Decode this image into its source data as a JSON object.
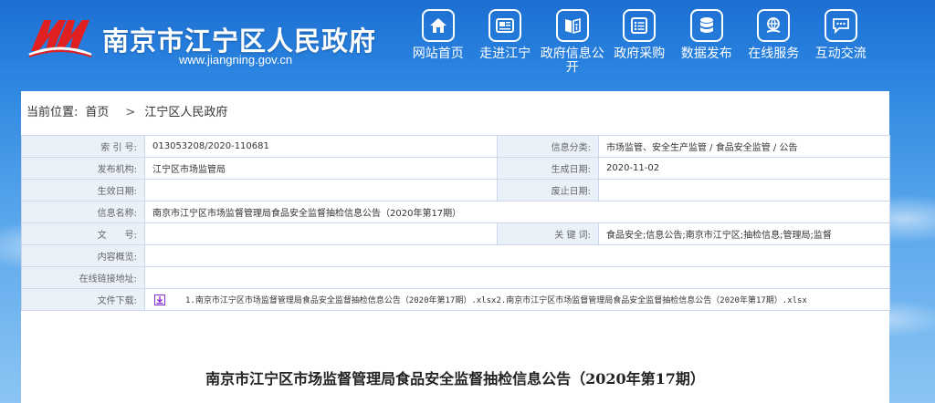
{
  "header": {
    "site_title": "南京市江宁区人民政府",
    "site_url": "www.jiangning.gov.cn"
  },
  "nav": [
    {
      "label": "网站首页",
      "icon": "home-icon"
    },
    {
      "label": "走进江宁",
      "icon": "newspaper-icon"
    },
    {
      "label": "政府信息公开",
      "icon": "info-book-icon"
    },
    {
      "label": "政府采购",
      "icon": "list-icon"
    },
    {
      "label": "数据发布",
      "icon": "database-icon"
    },
    {
      "label": "在线服务",
      "icon": "globe-hand-icon"
    },
    {
      "label": "互动交流",
      "icon": "chat-icon"
    }
  ],
  "breadcrumb": {
    "prefix": "当前位置:",
    "home": "首页",
    "separator": ">",
    "current": "江宁区人民政府"
  },
  "meta": {
    "index_label": "索 引 号:",
    "index_value": "013053208/2020-110681",
    "category_label": "信息分类:",
    "category_value": "市场监管、安全生产监管 / 食品安全监管 / 公告",
    "org_label": "发布机构:",
    "org_value": "江宁区市场监管局",
    "date_label": "生成日期:",
    "date_value": "2020-11-02",
    "effective_label": "生效日期:",
    "effective_value": "",
    "expired_label": "废止日期:",
    "expired_value": "",
    "name_label": "信息名称:",
    "name_value": "南京市江宁区市场监督管理局食品安全监督抽检信息公告（2020年第17期）",
    "docno_label": "文　　号:",
    "docno_value": "",
    "keywords_label": "关 键 词:",
    "keywords_value": "食品安全;信息公告;南京市江宁区;抽检信息;管理局;监督",
    "overview_label": "内容概览:",
    "overview_value": "",
    "link_label": "在线链接地址:",
    "link_value": "",
    "download_label": "文件下载:",
    "download_value": "1.南京市江宁区市场监督管理局食品安全监督抽检信息公告（2020年第17期）.xlsx2.南京市江宁区市场监督管理局食品安全监督抽检信息公告（2020年第17期）.xlsx"
  },
  "document_title": "南京市江宁区市场监督管理局食品安全监督抽检信息公告（2020年第17期）",
  "colors": {
    "header_blue": "#1d6fd2",
    "label_bg": "#eaf1f9",
    "border": "#c9d8ea",
    "logo_red": "#e02020",
    "download_purple": "#8a2bd8"
  }
}
